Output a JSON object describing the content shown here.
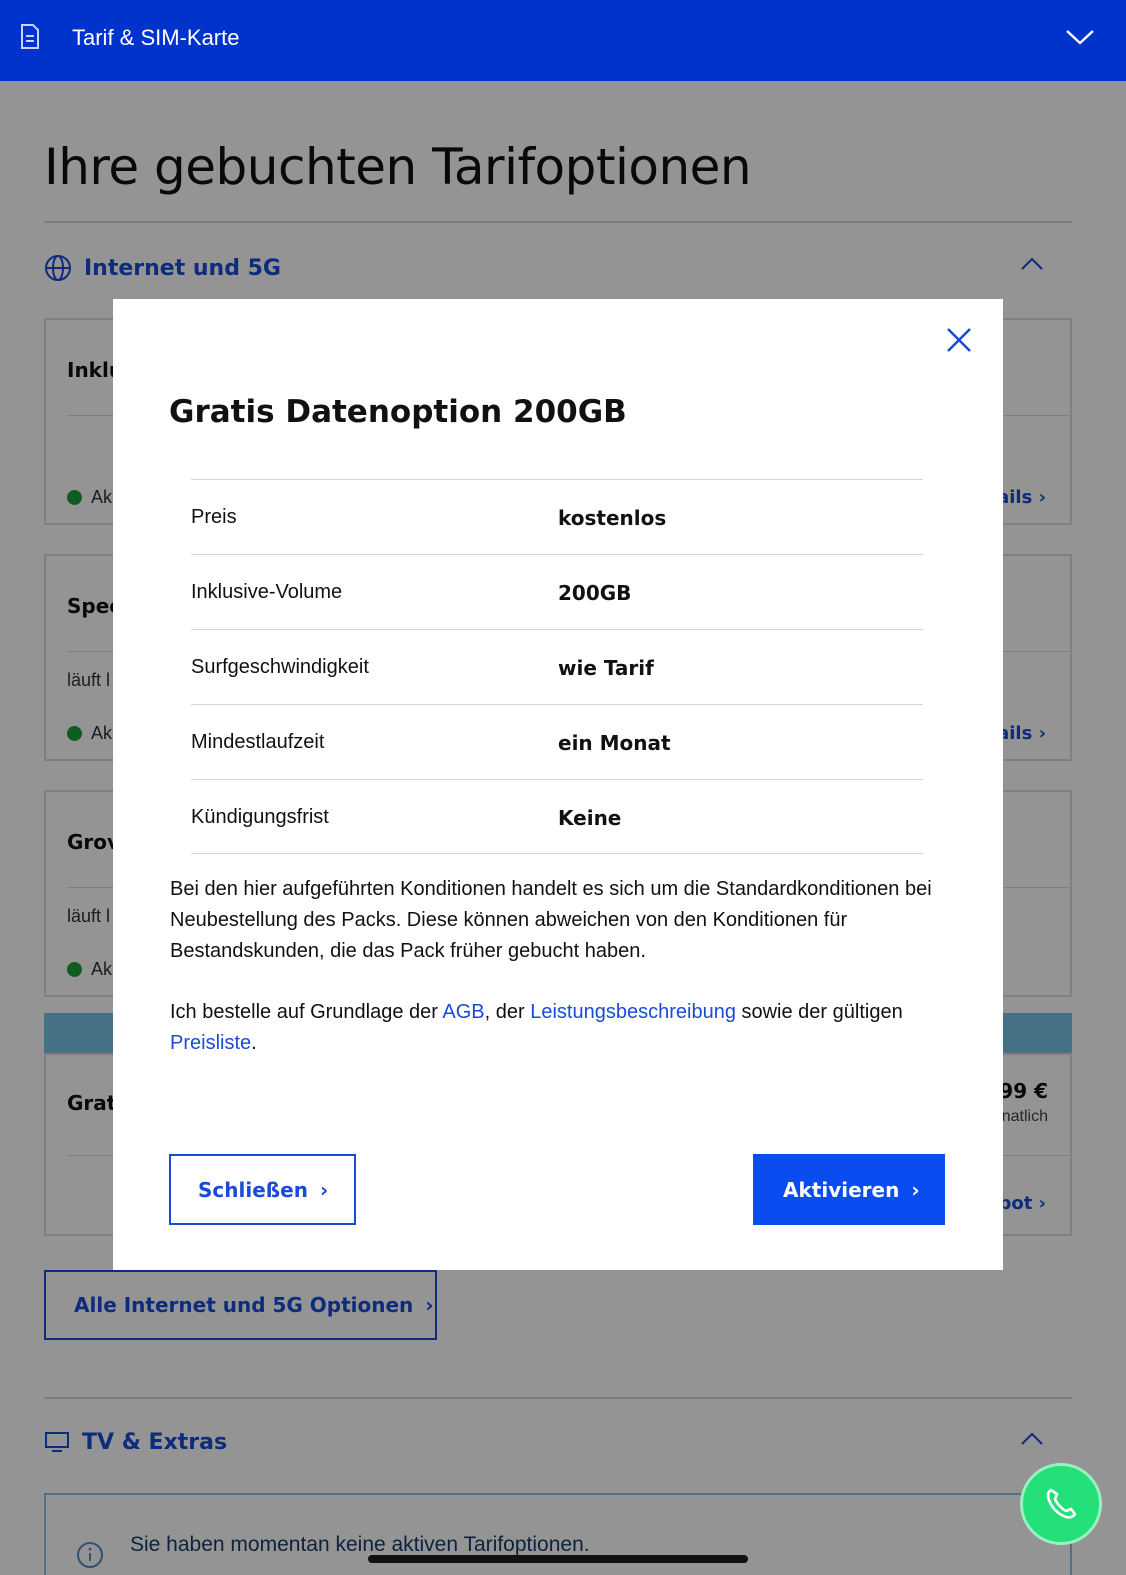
{
  "header": {
    "title": "Tarif & SIM-Karte",
    "icon": "document-icon",
    "chevron": "chevron-down-icon"
  },
  "page": {
    "title": "Ihre gebuchten Tarifoptionen",
    "sections": [
      {
        "label": "Internet und 5G",
        "icon": "globe-icon"
      },
      {
        "label": "TV & Extras",
        "icon": "tv-icon"
      }
    ],
    "cards": [
      {
        "title": "Inklu",
        "status": "Ak",
        "link": "ails"
      },
      {
        "title": "Spee",
        "sub": "läuft l",
        "status": "Ak",
        "link": "ails"
      },
      {
        "title": "Grov",
        "sub": "läuft l",
        "status": "Ak"
      },
      {
        "title": "Grat",
        "price": "99 €",
        "price_sub": "natlich",
        "link": "bot"
      }
    ],
    "all_options_button": "Alle Internet und 5G Optionen",
    "tv_empty_text": "Sie haben momentan keine aktiven Tarifoptionen."
  },
  "modal": {
    "title": "Gratis Datenoption 200GB",
    "rows": [
      {
        "key": "Preis",
        "value": "kostenlos"
      },
      {
        "key": "Inklusive-Volume",
        "value": "200GB"
      },
      {
        "key": "Surfgeschwindigkeit",
        "value": "wie Tarif"
      },
      {
        "key": "Mindestlaufzeit",
        "value": "ein Monat"
      },
      {
        "key": "Kündigungsfrist",
        "value": "Keine"
      }
    ],
    "disclaimer": "Bei den hier aufgeführten Konditionen handelt es sich um die Standardkonditionen bei Neubestellung des Packs. Diese können abweichen von den Konditionen für Bestandskunden, die das Pack früher gebucht haben.",
    "order": {
      "p1": "Ich bestelle auf Grundlage der ",
      "agb": "AGB",
      "p2": ", der ",
      "leistung": "Leistungsbeschreibung",
      "p3": " sowie der gültigen ",
      "preisliste": "Preisliste",
      "p4": "."
    },
    "close_button": "Schließen",
    "activate_button": "Aktivieren"
  },
  "colors": {
    "brand": "#0033cc",
    "accent": "#0a4cf0",
    "link": "#1a4bd6",
    "status_active": "#1aa13a",
    "call_button": "#24e07a"
  }
}
